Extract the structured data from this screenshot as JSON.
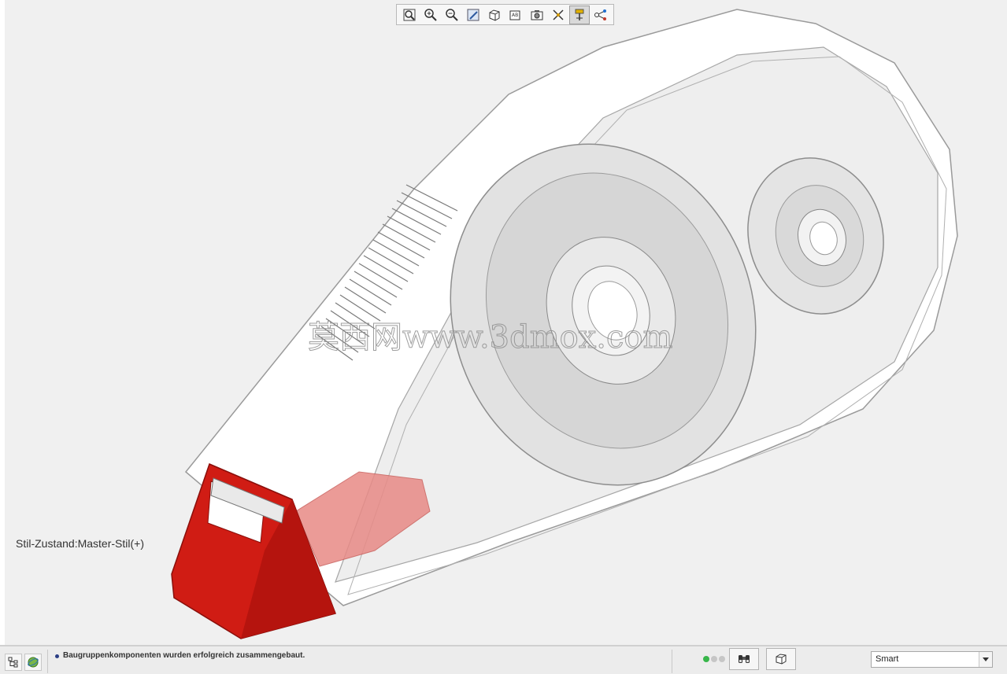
{
  "toolbar": {
    "buttons": [
      {
        "icon": "zoom-fit-icon"
      },
      {
        "icon": "zoom-in-icon"
      },
      {
        "icon": "zoom-out-icon"
      },
      {
        "icon": "repaint-icon"
      },
      {
        "icon": "display-style-icon"
      },
      {
        "icon": "saved-orientations-icon",
        "label": "AB"
      },
      {
        "icon": "view-manager-icon"
      },
      {
        "icon": "datum-display-icon"
      },
      {
        "icon": "spin-center-icon",
        "active": true
      },
      {
        "icon": "annotation-display-icon"
      }
    ]
  },
  "viewport": {
    "style_state": "Stil-Zustand:Master-Stil(+)",
    "watermark": "莫西网www.3dmox.com"
  },
  "status_bar": {
    "message": "Baugruppenkomponenten wurden erfolgreich zusammengebaut.",
    "filter_value": "Smart",
    "indicator_colors": [
      "#38b64a",
      "#c6c6c6",
      "#c6c6c6"
    ]
  },
  "colors": {
    "accent_red": "#d01c14",
    "viewport_bg": "#f0f0f0"
  }
}
